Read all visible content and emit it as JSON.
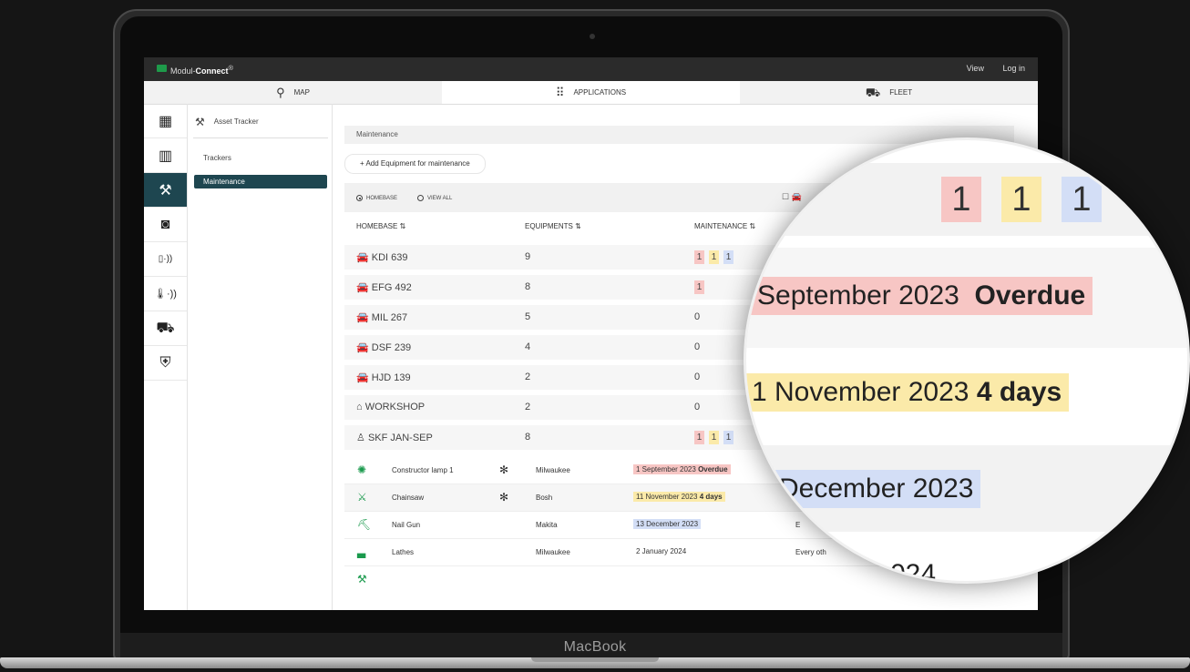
{
  "device": {
    "brand": "MacBook"
  },
  "app": {
    "logo_prefix": "Modul-",
    "logo_strong": "Connect",
    "logo_mark": "®",
    "view_label": "View",
    "login_label": "Log in"
  },
  "navtabs": [
    {
      "label": "MAP",
      "icon": "map-icon"
    },
    {
      "label": "APPLICATIONS",
      "icon": "grid-icon"
    },
    {
      "label": "FLEET",
      "icon": "car-icon"
    }
  ],
  "iconrail": [
    "dashboard-icon",
    "building-icon",
    "drill-icon",
    "camera-icon",
    "signal-icon",
    "temperature-icon",
    "truck-icon",
    "shield-lock-icon"
  ],
  "subnav": {
    "title": "Asset Tracker",
    "items": [
      "Trackers",
      "Maintenance"
    ]
  },
  "main": {
    "breadcrumb": "Maintenance",
    "add_button": "+ Add Equipment for maintenance",
    "filter": {
      "homebase": "HOMEBASE",
      "view_all": "VIEW ALL"
    },
    "headers": {
      "homebase": "HOMEBASE ⇅",
      "equipments": "EQUIPMENTS ⇅",
      "maintenance": "MAINTENANCE ⇅"
    },
    "rows": [
      {
        "icon": "🚘",
        "name": "KDI 639",
        "equipments": "9",
        "maint": [
          "1",
          "1",
          "1"
        ]
      },
      {
        "icon": "🚘",
        "name": "EFG 492",
        "equipments": "8",
        "maint": [
          "1"
        ]
      },
      {
        "icon": "🚘",
        "name": "MIL 267",
        "equipments": "5",
        "maint": [
          "0"
        ]
      },
      {
        "icon": "🚘",
        "name": "DSF 239",
        "equipments": "4",
        "maint": [
          "0"
        ]
      },
      {
        "icon": "🚘",
        "name": "HJD 139",
        "equipments": "2",
        "maint": [
          "0"
        ]
      },
      {
        "icon": "⌂",
        "name": "WORKSHOP",
        "equipments": "2",
        "maint": [
          "0"
        ]
      },
      {
        "icon": "♙",
        "name": "SKF JAN-SEP",
        "equipments": "8",
        "maint": [
          "1",
          "1",
          "1"
        ]
      }
    ],
    "equipment": [
      {
        "name": "Constructor lamp 1",
        "bt": true,
        "maker": "Milwaukee",
        "date": "1 September 2023",
        "status": "Overdue",
        "freq": ""
      },
      {
        "name": "Chainsaw",
        "bt": true,
        "maker": "Bosh",
        "date": "11 November 2023",
        "status": "4 days",
        "freq": ""
      },
      {
        "name": "Nail Gun",
        "bt": false,
        "maker": "Makita",
        "date": "13 December 2023",
        "status": "",
        "freq": "E"
      },
      {
        "name": "Lathes",
        "bt": false,
        "maker": "Milwaukee",
        "date": "2 January 2024",
        "status": "",
        "freq": "Every oth"
      }
    ]
  },
  "magnifier": {
    "badges": [
      "1",
      "1",
      "1"
    ],
    "line1_date": "September 2023",
    "line1_status": "Overdue",
    "line2_date": "1 November 2023",
    "line2_status": "4 days",
    "line3_date": "December 2023",
    "line4_partial": "024"
  },
  "colors": {
    "accent": "#1e4650",
    "overdue": "#f7c6c4",
    "soon": "#fbeaa9",
    "scheduled": "#d3def6",
    "green": "#1e9a4a"
  }
}
